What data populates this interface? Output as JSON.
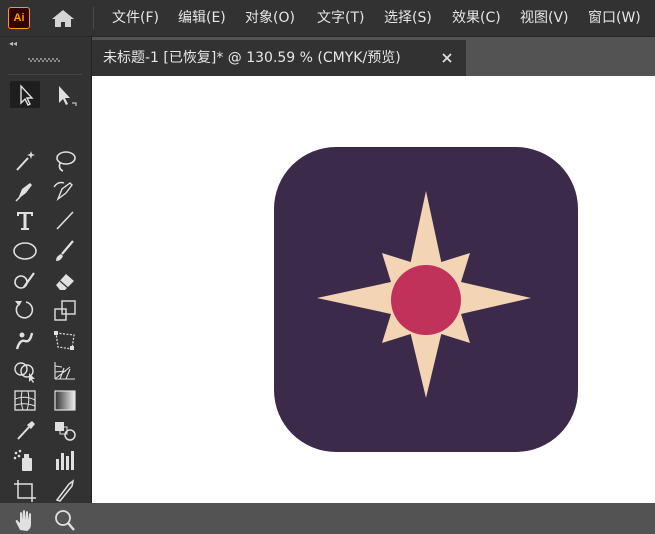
{
  "app": {
    "logo_text": "Ai"
  },
  "menu": {
    "items": [
      "文件(F)",
      "编辑(E)",
      "对象(O)",
      "文字(T)",
      "选择(S)",
      "效果(C)",
      "视图(V)",
      "窗口(W)"
    ]
  },
  "document": {
    "tab_label": "未标题-1 [已恢复]* @ 130.59 % (CMYK/预览)"
  },
  "toolbar": {
    "tools": [
      "selection-tool",
      "direct-selection-tool",
      "magic-wand-tool",
      "lasso-tool",
      "pen-tool",
      "curvature-tool",
      "type-tool",
      "line-segment-tool",
      "ellipse-tool",
      "paintbrush-tool",
      "shaper-tool",
      "eraser-tool",
      "rotate-tool",
      "scale-tool",
      "puppet-warp-tool",
      "free-transform-tool",
      "shape-builder-tool",
      "perspective-grid-tool",
      "mesh-tool",
      "gradient-tool",
      "eyedropper-tool",
      "blend-tool",
      "symbol-sprayer-tool",
      "column-graph-tool",
      "artboard-tool",
      "slice-tool",
      "hand-tool",
      "zoom-tool"
    ],
    "active_tool": "selection-tool"
  },
  "colors": {
    "icon_background": "#3b2a4a",
    "star": "#f3d5b5",
    "center_circle": "#c0325a",
    "ui_dark": "#323232",
    "ui_mid": "#535353",
    "logo_orange": "#ff9a00"
  }
}
